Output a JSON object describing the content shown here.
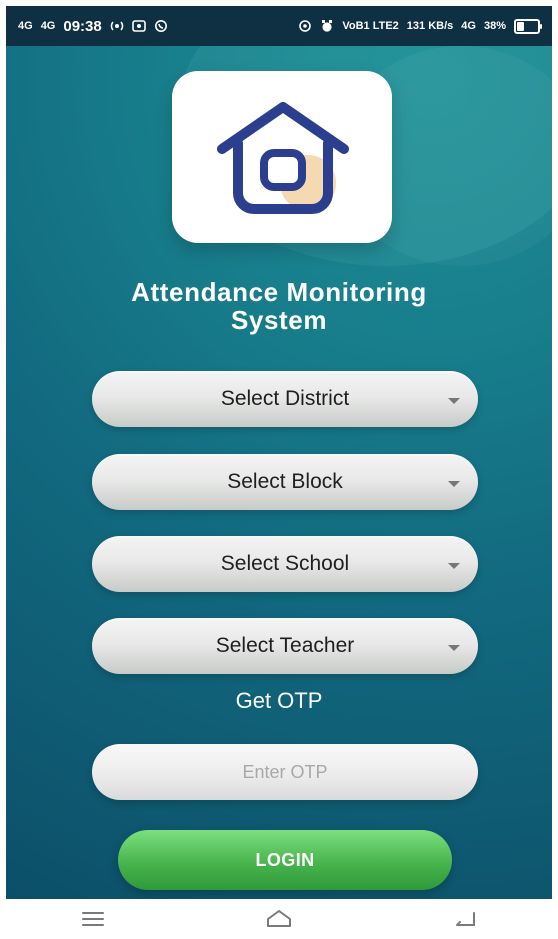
{
  "statusbar": {
    "network_left_1": "4G",
    "network_left_2": "4G",
    "time": "09:38",
    "volte": "VoB1 LTE2",
    "speed": "131 KB/s",
    "network_right": "4G",
    "battery_percent": "38%",
    "battery_level": 0.38
  },
  "app": {
    "title_line1": "Attendance Monitoring",
    "title_line2": "System"
  },
  "form": {
    "district_label": "Select District",
    "block_label": "Select Block",
    "school_label": "Select School",
    "teacher_label": "Select Teacher",
    "get_otp_label": "Get OTP",
    "otp_placeholder": "Enter OTP",
    "otp_value": "",
    "login_label": "LOGIN"
  },
  "icons": {
    "logo": "house-icon",
    "dropdown": "chevron-down-icon",
    "nav": [
      "menu-icon",
      "home-icon",
      "back-icon"
    ]
  },
  "colors": {
    "brand_teal": "#187f8c",
    "brand_dark": "#0c4f68",
    "login_green": "#45b14b",
    "logo_stroke": "#2c3f8f",
    "logo_accent": "#f5d9b0"
  }
}
